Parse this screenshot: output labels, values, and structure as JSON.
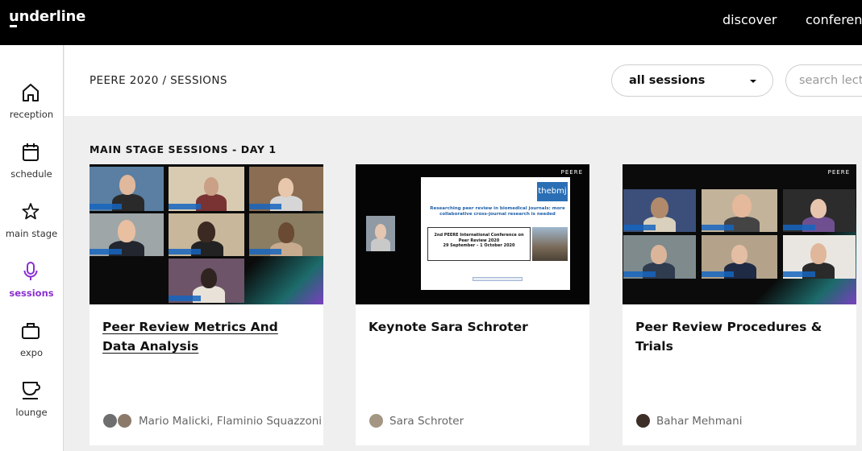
{
  "app": {
    "logo": "underline"
  },
  "topnav": {
    "discover": "discover",
    "conferences": "conferenc"
  },
  "sidebar": {
    "items": [
      {
        "label": "reception",
        "icon": "home-icon"
      },
      {
        "label": "schedule",
        "icon": "calendar-icon"
      },
      {
        "label": "main stage",
        "icon": "star-icon"
      },
      {
        "label": "sessions",
        "icon": "microphone-icon",
        "active": true
      },
      {
        "label": "expo",
        "icon": "briefcase-icon"
      },
      {
        "label": "lounge",
        "icon": "cup-icon"
      }
    ],
    "active_color": "#8a2fd1"
  },
  "header": {
    "breadcrumb": "PEERE 2020 / SESSIONS",
    "filter_value": "all sessions",
    "search_placeholder": "search lect"
  },
  "main": {
    "section_title": "MAIN STAGE SESSIONS - DAY 1",
    "cards": [
      {
        "title": "Peer Review Metrics And Data Analysis",
        "speakers": "Mario Malicki, Flaminio Squazzoni"
      },
      {
        "title": "Keynote Sara Schroter",
        "speakers": "Sara Schroter",
        "slide": {
          "logo": "thebmj",
          "heading": "Researching peer review in biomedical journals: more collaborative cross-journal research is needed",
          "conf_line1": "2nd PEERE International Conference on",
          "conf_line2": "Peer Review 2020",
          "conf_line3": "29 September – 1 October 2020"
        },
        "brand": "PEERE"
      },
      {
        "title": "Peer Review Procedures & Trials",
        "speakers": "Bahar Mehmani",
        "brand": "PEERE"
      }
    ]
  }
}
